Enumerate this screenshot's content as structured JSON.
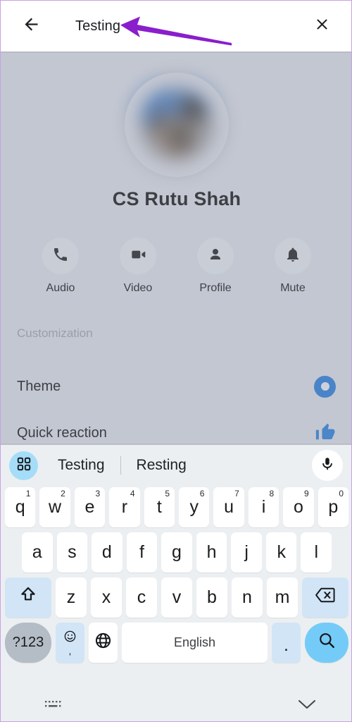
{
  "appbar": {
    "back_icon": "arrow-left-icon",
    "query": "Testing",
    "close_icon": "close-icon"
  },
  "annotation": {
    "type": "arrow",
    "color": "#8a1ecb",
    "points_to": "Testing"
  },
  "profile": {
    "avatar_alt": "blurred-profile-photo",
    "name": "CS Rutu Shah",
    "actions": [
      {
        "label": "Audio",
        "icon": "phone-icon"
      },
      {
        "label": "Video",
        "icon": "video-camera-icon"
      },
      {
        "label": "Profile",
        "icon": "person-icon"
      },
      {
        "label": "Mute",
        "icon": "bell-icon"
      }
    ]
  },
  "settings": {
    "section_header": "Customization",
    "rows": [
      {
        "label": "Theme",
        "trailing_icon": "color-circle-icon",
        "trailing_color": "#4a84c8"
      },
      {
        "label": "Quick reaction",
        "trailing_icon": "thumbs-up-icon",
        "trailing_color": "#4a84c8"
      }
    ]
  },
  "keyboard": {
    "grid_icon": "apps-grid-icon",
    "mic_icon": "microphone-icon",
    "suggestions": [
      "Testing",
      "Resting"
    ],
    "row1": [
      {
        "key": "q",
        "num": "1"
      },
      {
        "key": "w",
        "num": "2"
      },
      {
        "key": "e",
        "num": "3"
      },
      {
        "key": "r",
        "num": "4"
      },
      {
        "key": "t",
        "num": "5"
      },
      {
        "key": "y",
        "num": "6"
      },
      {
        "key": "u",
        "num": "7"
      },
      {
        "key": "i",
        "num": "8"
      },
      {
        "key": "o",
        "num": "9"
      },
      {
        "key": "p",
        "num": "0"
      }
    ],
    "row2": [
      "a",
      "s",
      "d",
      "f",
      "g",
      "h",
      "j",
      "k",
      "l"
    ],
    "row3": [
      "z",
      "x",
      "c",
      "v",
      "b",
      "n",
      "m"
    ],
    "shift_icon": "shift-up-icon",
    "backspace_icon": "backspace-icon",
    "symbols_key": "?123",
    "emoji_icon": "emoji-smiley-icon",
    "emoji_comma": ",",
    "globe_icon": "globe-language-icon",
    "space_label": "English",
    "period_key": ".",
    "search_icon": "search-icon"
  },
  "navbar": {
    "keyboard_icon": "keyboard-dots-icon",
    "hide_icon": "chevron-down-icon"
  },
  "colors": {
    "accent_blue": "#4a84c8",
    "keyboard_bg": "#eceff1",
    "mod_key": "#d2e5f7",
    "send_key": "#74cbf8",
    "dim_bg": "#c3c7d1",
    "annotation_purple": "#8a1ecb"
  }
}
